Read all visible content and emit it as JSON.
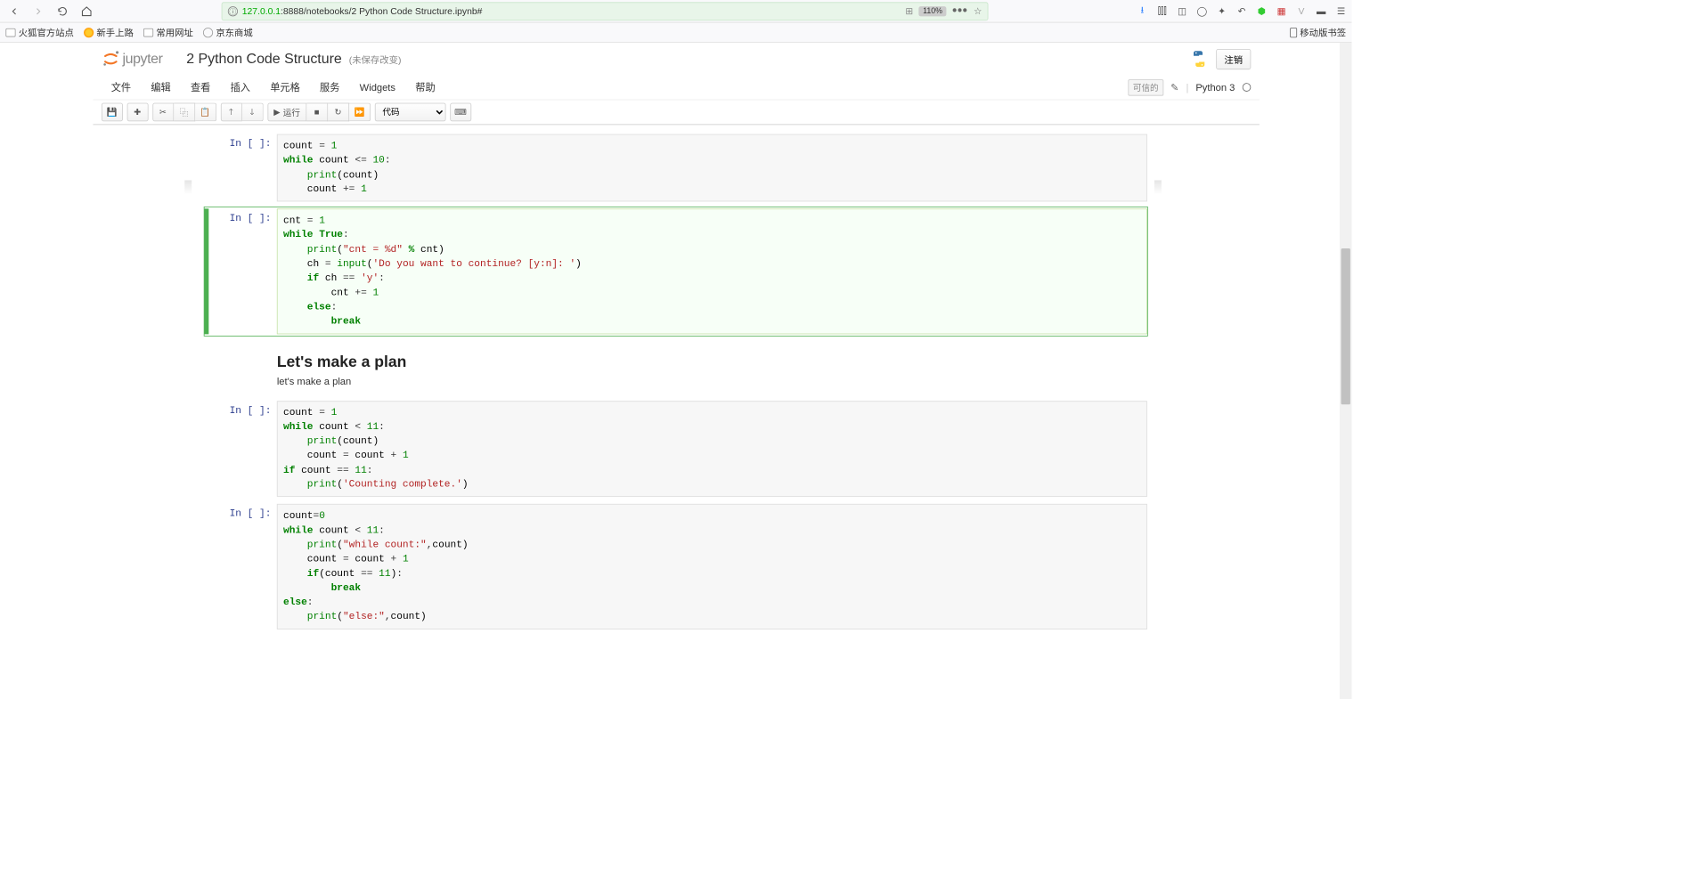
{
  "browser": {
    "url_host": "127.0.0.1",
    "url_path": ":8888/notebooks/2 Python Code Structure.ipynb#",
    "zoom": "110%"
  },
  "bookmarks": {
    "firefox_site": "火狐官方站点",
    "getting_started": "新手上路",
    "common": "常用网址",
    "jd": "京东商城",
    "mobile": "移动版书签"
  },
  "notebook": {
    "brand": "jupyter",
    "title": "2 Python Code Structure",
    "saved_status": "(未保存改变)",
    "logout": "注销",
    "trusted": "可信的",
    "kernel": "Python 3",
    "menu": {
      "file": "文件",
      "edit": "编辑",
      "view": "查看",
      "insert": "插入",
      "cell": "单元格",
      "kernel_menu": "服务",
      "widgets": "Widgets",
      "help": "帮助"
    },
    "toolbar": {
      "run": "运行",
      "cell_type": "代码"
    }
  },
  "cells": {
    "c0_prompt": "In [ ]:",
    "c1_prompt": "In [ ]:",
    "c2_prompt": "In [ ]:",
    "c3_prompt": "In [ ]:",
    "md_heading": "Let's make a plan",
    "md_text": "let's make a plan"
  }
}
